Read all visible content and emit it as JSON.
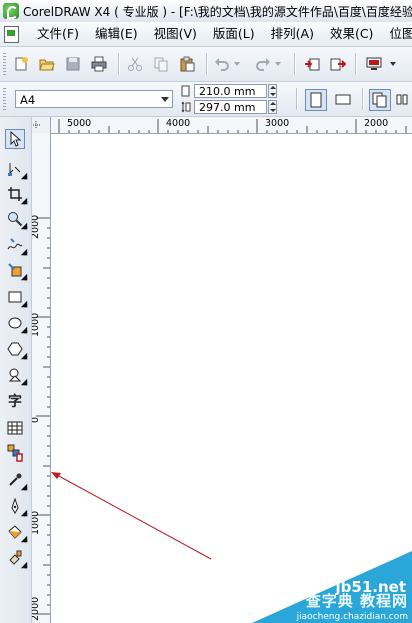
{
  "window": {
    "title": "CorelDRAW X4 ( 专业版 ) - [F:\\我的文档\\我的源文件作品\\百度\\百度经验"
  },
  "menu": {
    "items": [
      "文件(F)",
      "编辑(E)",
      "视图(V)",
      "版面(L)",
      "排列(A)",
      "效果(C)",
      "位图"
    ]
  },
  "toolbar": {
    "icons": [
      "new-icon",
      "open-icon",
      "save-icon",
      "print-icon",
      "cut-icon",
      "copy-icon",
      "paste-icon",
      "undo-icon",
      "redo-icon",
      "import-icon",
      "export-icon",
      "application-launcher-icon"
    ]
  },
  "property_bar": {
    "page_size": "A4",
    "width": "210.0 mm",
    "height": "297.0 mm"
  },
  "rulers": {
    "top_ticks": [
      "5000",
      "4000",
      "3000",
      "2000"
    ],
    "left_ticks": [
      "2000",
      "1000",
      "0",
      "1000",
      "2000"
    ]
  },
  "toolbox": {
    "tools": [
      "pick-tool",
      "shape-tool",
      "crop-tool",
      "zoom-tool",
      "freehand-tool",
      "smart-fill-tool",
      "rectangle-tool",
      "ellipse-tool",
      "polygon-tool",
      "basic-shapes-tool",
      "text-tool",
      "table-tool",
      "interactive-blend-tool",
      "eyedropper-tool",
      "outline-tool",
      "fill-tool",
      "interactive-fill-tool"
    ],
    "text_tool_glyph": "字"
  },
  "annotation": {
    "arrow_color": "#c0181c"
  },
  "watermark": {
    "site": "jb51.net",
    "text": "查字典 教程网",
    "url": "jiaocheng.chazidian.com"
  }
}
